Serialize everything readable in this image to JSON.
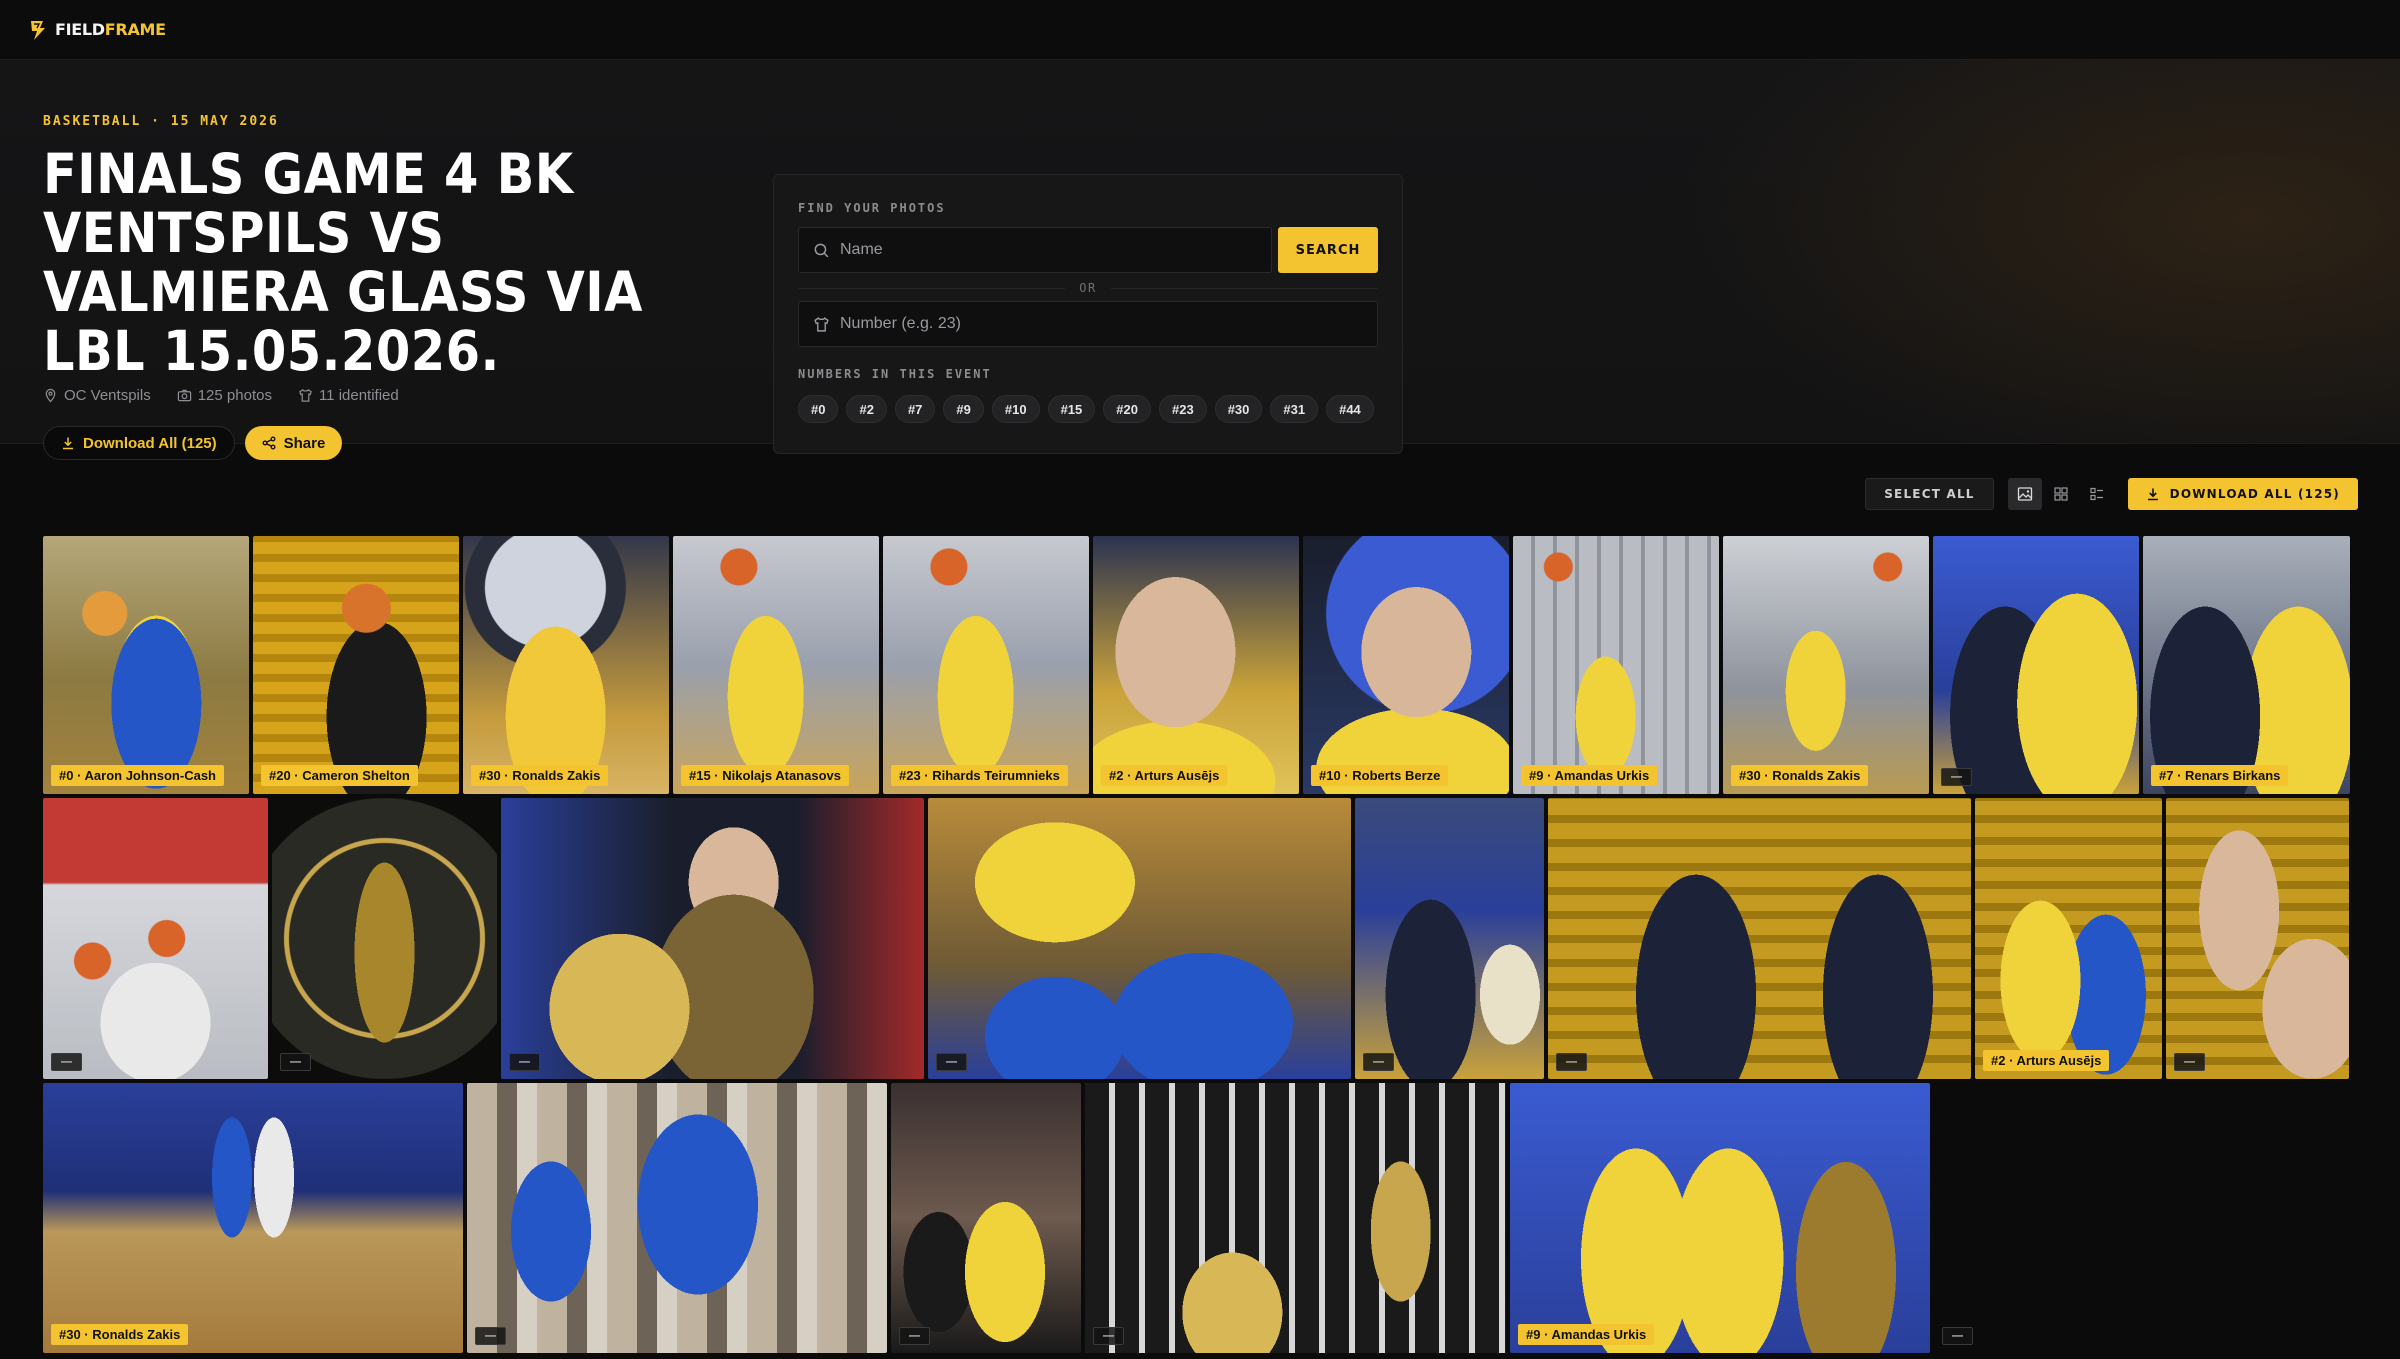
{
  "brand": {
    "name_a": "FIELD",
    "name_b": "FRAME"
  },
  "event": {
    "eyebrow": "BASKETBALL · 15 MAY 2026",
    "title": "FINALS GAME 4 BK VENTSPILS VS VALMIERA GLASS VIA LBL 15.05.2026.",
    "location": "OC Ventspils",
    "photos": "125 photos",
    "identified": "11 identified",
    "download_label": "Download All (125)",
    "share_label": "Share"
  },
  "finder": {
    "label": "FIND YOUR PHOTOS",
    "name_placeholder": "Name",
    "search_label": "SEARCH",
    "or_label": "OR",
    "number_placeholder": "Number (e.g. 23)",
    "numbers_label": "NUMBERS IN THIS EVENT",
    "numbers": [
      "#0",
      "#2",
      "#7",
      "#9",
      "#10",
      "#15",
      "#20",
      "#23",
      "#30",
      "#31",
      "#44"
    ]
  },
  "toolbar": {
    "select_all": "SELECT ALL",
    "download_all": "DOWNLOAD ALL (125)",
    "views": [
      "single-image-view-icon",
      "grid-view-icon",
      "list-view-icon"
    ],
    "active_view": 0
  },
  "colors": {
    "accent": "#f4c430",
    "background": "#0b0b0c",
    "panel": "#171718"
  },
  "gallery": {
    "rows": [
      [
        {
          "label": "#0 · Aaron Johnson-Cash",
          "style": "p-arena-yellow"
        },
        {
          "label": "#20 · Cameron Shelton",
          "style": "p-seats"
        },
        {
          "label": "#30 · Ronalds Zakis",
          "style": "p-court-logo"
        },
        {
          "label": "#15 · Nikolajs Atanasovs",
          "style": "p-shoot"
        },
        {
          "label": "#23 · Rihards Teirumnieks",
          "style": "p-shoot"
        },
        {
          "label": "#2 · Arturs Ausējs",
          "style": "p-close"
        },
        {
          "label": "#10 · Roberts Berze",
          "style": "p-dark-close"
        },
        {
          "label": "#9 · Amandas Urkis",
          "style": "p-hall"
        },
        {
          "label": "#30 · Ronalds Zakis",
          "style": "p-hall2"
        },
        {
          "label": "—",
          "style": "p-coach"
        },
        {
          "label": "#7 · Renars Birkans",
          "style": "p-coach2"
        }
      ],
      [
        {
          "label": "—",
          "style": "p-hoop"
        },
        {
          "label": "—",
          "style": "p-trophy"
        },
        {
          "label": "—",
          "style": "p-cheer"
        },
        {
          "label": "—",
          "style": "p-huddle"
        },
        {
          "label": "—",
          "style": "p-suit"
        },
        {
          "label": "—",
          "style": "p-suits2"
        },
        {
          "label": "#2 · Arturs Ausējs",
          "style": "p-highfive"
        },
        {
          "label": "—",
          "style": "p-hands"
        }
      ],
      [
        {
          "label": "#30 · Ronalds Zakis",
          "style": "p-jump"
        },
        {
          "label": "—",
          "style": "p-crowd"
        },
        {
          "label": "—",
          "style": "p-crowd2"
        },
        {
          "label": "—",
          "style": "p-ceremony"
        },
        {
          "label": "#9 · Amandas Urkis",
          "style": "p-lineup"
        },
        {
          "label": "—",
          "style": "p-ref"
        }
      ]
    ]
  }
}
